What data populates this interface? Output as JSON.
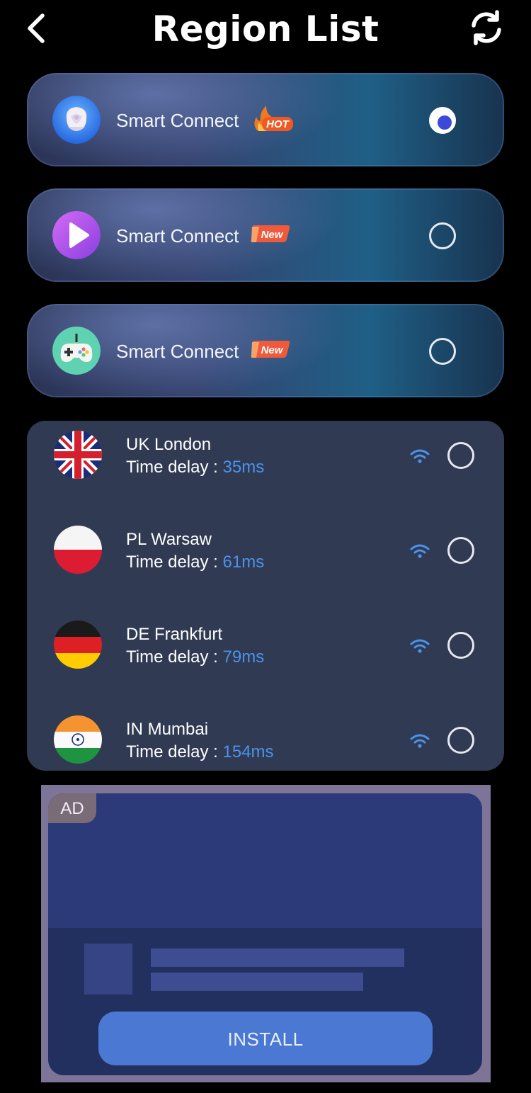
{
  "header": {
    "title": "Region List",
    "back_icon": "chevron-left-icon",
    "refresh_icon": "refresh-icon"
  },
  "smart_connect": [
    {
      "label": "Smart Connect",
      "badge": "HOT",
      "icon": "rose-icon",
      "selected": true
    },
    {
      "label": "Smart Connect",
      "badge": "New",
      "icon": "play-icon",
      "selected": false
    },
    {
      "label": "Smart Connect",
      "badge": "New",
      "icon": "gamepad-icon",
      "selected": false
    }
  ],
  "regions": [
    {
      "name": "UK London",
      "delay_label": "Time delay : ",
      "delay": "35ms",
      "flag": "uk-flag-icon",
      "selected": false
    },
    {
      "name": "PL Warsaw",
      "delay_label": "Time delay : ",
      "delay": "61ms",
      "flag": "poland-flag-icon",
      "selected": false
    },
    {
      "name": "DE Frankfurt",
      "delay_label": "Time delay : ",
      "delay": "79ms",
      "flag": "germany-flag-icon",
      "selected": false
    },
    {
      "name": "IN Mumbai",
      "delay_label": "Time delay : ",
      "delay": "154ms",
      "flag": "india-flag-icon",
      "selected": false
    }
  ],
  "ad": {
    "badge": "AD",
    "install_label": "INSTALL"
  },
  "colors": {
    "accent_selected": "#3d49d8",
    "delay_value": "#4b93ec",
    "panel_bg": "#303a52",
    "install_button": "#4a78d2"
  }
}
